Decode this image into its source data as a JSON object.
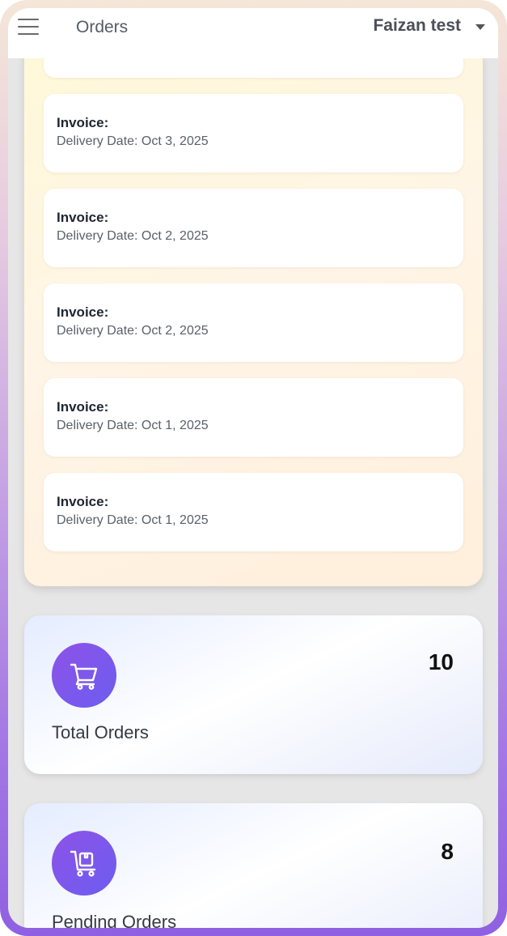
{
  "header": {
    "title": "Orders",
    "user_name": "Faizan test"
  },
  "orders": [
    {
      "label": "Invoice:",
      "date": "Delivery Date: Oct 3, 2025"
    },
    {
      "label": "Invoice:",
      "date": "Delivery Date: Oct 2, 2025"
    },
    {
      "label": "Invoice:",
      "date": "Delivery Date: Oct 2, 2025"
    },
    {
      "label": "Invoice:",
      "date": "Delivery Date: Oct 1, 2025"
    },
    {
      "label": "Invoice:",
      "date": "Delivery Date: Oct 1, 2025"
    }
  ],
  "stats": {
    "total": {
      "label": "Total Orders",
      "value": "10",
      "icon": "cart-icon"
    },
    "pending": {
      "label": "Pending Orders",
      "value": "8",
      "icon": "cart-box-icon"
    }
  },
  "colors": {
    "accent": "#7c5aec",
    "frame": "#9a6ee3"
  }
}
